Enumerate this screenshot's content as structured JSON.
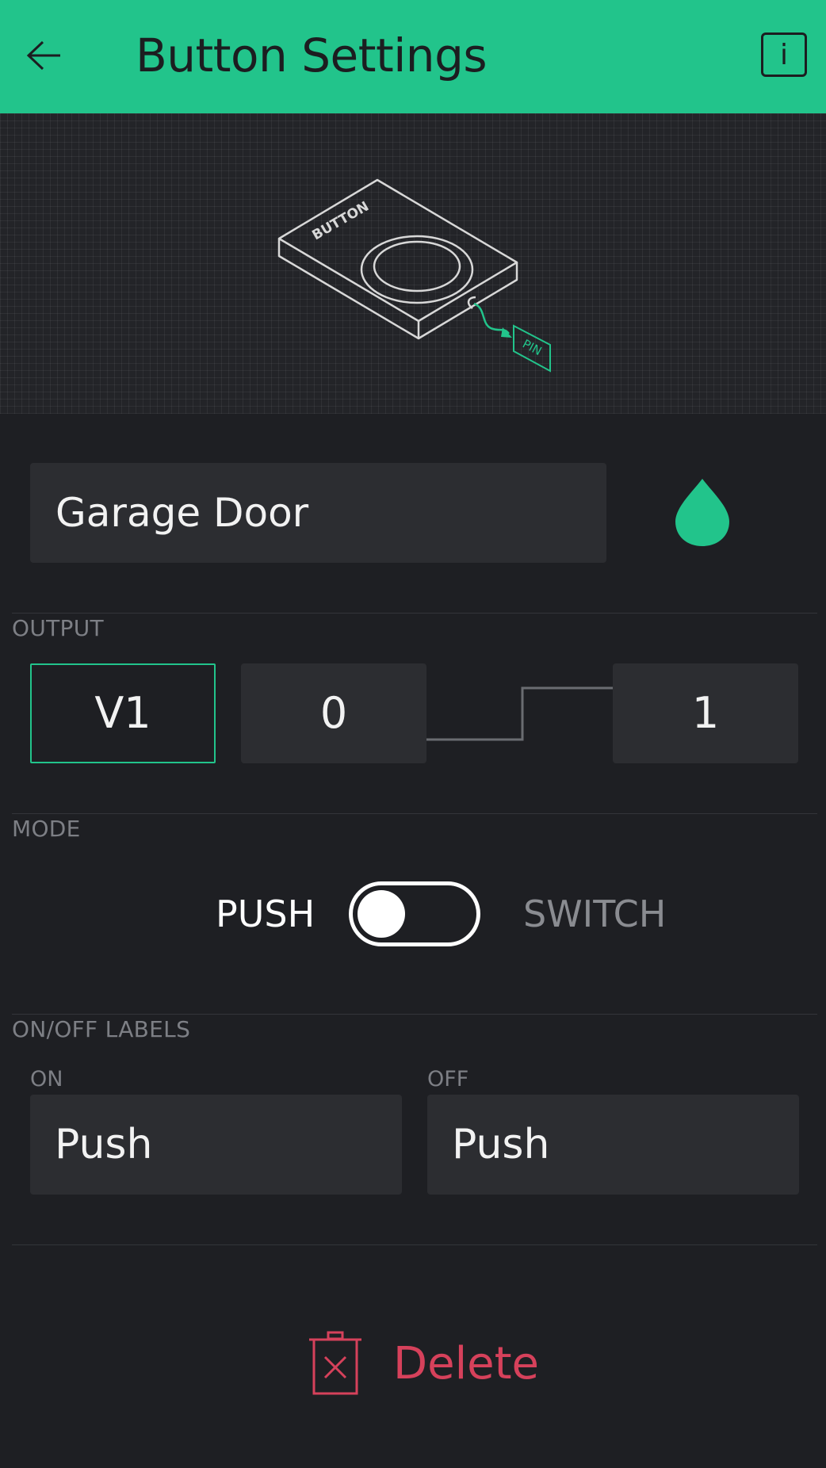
{
  "header": {
    "title": "Button Settings",
    "back_icon": "arrow-left-icon",
    "info_label": "i"
  },
  "illustration": {
    "device_label": "BUTTON",
    "pin_label": "PIN"
  },
  "name_field": {
    "value": "Garage Door",
    "color_icon": "drop-icon",
    "color": "#22c48b"
  },
  "output": {
    "section_label": "OUTPUT",
    "pin": "V1",
    "low_value": "0",
    "high_value": "1"
  },
  "mode": {
    "section_label": "MODE",
    "push_label": "PUSH",
    "switch_label": "SWITCH",
    "selected": "PUSH"
  },
  "labels": {
    "section_label": "ON/OFF LABELS",
    "on_label": "ON",
    "off_label": "OFF",
    "on_value": "Push",
    "off_value": "Push"
  },
  "delete": {
    "label": "Delete",
    "icon": "trash-icon",
    "color": "#d6415b"
  },
  "colors": {
    "accent": "#22c48b",
    "background": "#1e1f23",
    "field": "#2c2d31"
  }
}
